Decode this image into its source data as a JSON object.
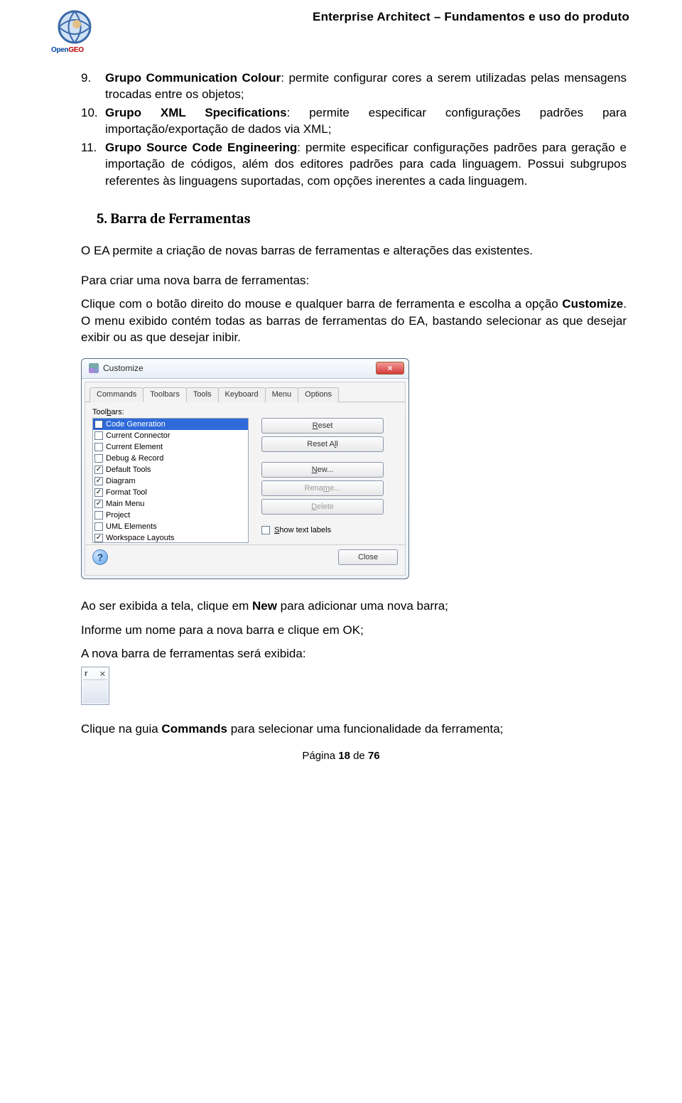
{
  "header": {
    "logo_text_prefix": "Open",
    "logo_text_suffix": "GEO",
    "doc_title": "Enterprise Architect – Fundamentos e uso do produto"
  },
  "items": [
    {
      "num": "9.",
      "bold": "Grupo Communication Colour",
      "rest": ": permite configurar cores a serem utilizadas pelas mensagens trocadas entre os objetos;"
    },
    {
      "num": "10.",
      "bold": "Grupo XML Specifications",
      "rest": ": permite especificar configurações padrões para importação/exportação de dados via XML;"
    },
    {
      "num": "11.",
      "bold": "Grupo Source Code Engineering",
      "rest": ": permite especificar configurações padrões para geração e importação de códigos, além dos editores padrões para cada linguagem. Possui subgrupos referentes às linguagens suportadas, com opções inerentes a cada linguagem."
    }
  ],
  "section": {
    "num": "5.",
    "title": "Barra de Ferramentas"
  },
  "p1": "O EA permite a criação de novas barras de ferramentas e alterações das existentes.",
  "p2": "Para criar uma nova barra de ferramentas:",
  "p3_a": "Clique com o botão direito do mouse e qualquer barra de ferramenta e escolha a opção ",
  "p3_b": "Customize",
  "p3_c": ". O menu exibido contém todas as barras de ferramentas do EA, bastando selecionar as que desejar exibir ou as que desejar inibir.",
  "dialog": {
    "title": "Customize",
    "close": "×",
    "tabs": [
      "Commands",
      "Toolbars",
      "Tools",
      "Keyboard",
      "Menu",
      "Options"
    ],
    "active_tab": 1,
    "toolbars_label_pre": "Tool",
    "toolbars_label_u": "b",
    "toolbars_label_post": "ars:",
    "list": [
      {
        "label": "Code Generation",
        "checked": false,
        "selected": true
      },
      {
        "label": "Current Connector",
        "checked": false
      },
      {
        "label": "Current Element",
        "checked": false
      },
      {
        "label": "Debug & Record",
        "checked": false
      },
      {
        "label": "Default Tools",
        "checked": true
      },
      {
        "label": "Diagram",
        "checked": true
      },
      {
        "label": "Format Tool",
        "checked": true
      },
      {
        "label": "Main Menu",
        "checked": true
      },
      {
        "label": "Project",
        "checked": false
      },
      {
        "label": "UML Elements",
        "checked": false
      },
      {
        "label": "Workspace Layouts",
        "checked": true
      }
    ],
    "buttons": {
      "reset": {
        "u": "R",
        "rest": "eset"
      },
      "reset_all": {
        "pre": "Reset A",
        "u": "l",
        "post": "l"
      },
      "new_": {
        "u": "N",
        "rest": "ew..."
      },
      "rename": {
        "pre": "Rena",
        "u": "m",
        "post": "e..."
      },
      "delete": {
        "u": "D",
        "rest": "elete"
      }
    },
    "show_labels_pre": "",
    "show_labels_u": "S",
    "show_labels_post": "how text labels",
    "close_btn": "Close"
  },
  "p4_a": "Ao ser exibida a tela, clique em ",
  "p4_b": "New",
  "p4_c": " para adicionar uma nova barra;",
  "p5": "Informe um nome para a nova barra e clique em OK;",
  "p6": "A nova barra de ferramentas será exibida:",
  "mini": {
    "r": "r",
    "x": "✕"
  },
  "p7_a": "Clique na guia ",
  "p7_b": "Commands",
  "p7_c": " para selecionar uma funcionalidade da ferramenta;",
  "footer": {
    "pre": "Página ",
    "num": "18",
    "mid": " de ",
    "total": "76"
  }
}
